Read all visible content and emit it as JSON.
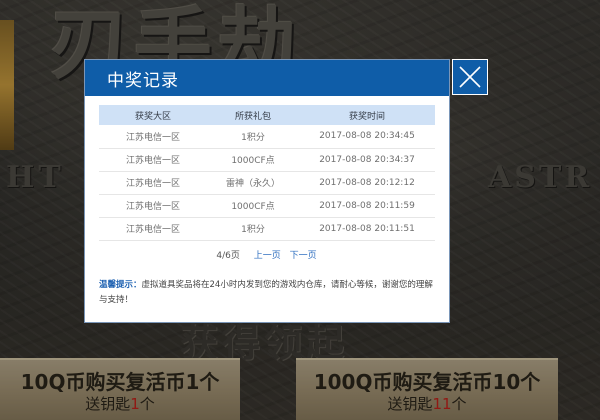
{
  "background": {
    "big_glyphs": "刃手劫",
    "word_left": "HT",
    "word_right": "ASTR",
    "subtitle": "获得领起",
    "cards": [
      {
        "line1": "10Q币购买复活币1个",
        "line2_prefix": "送钥匙",
        "line2_count": "1",
        "line2_suffix": "个"
      },
      {
        "line1": "100Q币购买复活币10个",
        "line2_prefix": "送钥匙",
        "line2_count": "11",
        "line2_suffix": "个"
      }
    ]
  },
  "modal": {
    "title": "中奖记录",
    "close_icon": "close-x-icon",
    "table": {
      "headers": [
        "获奖大区",
        "所获礼包",
        "获奖时间"
      ],
      "rows": [
        [
          "江苏电信一区",
          "1积分",
          "2017-08-08 20:34:45"
        ],
        [
          "江苏电信一区",
          "1000CF点",
          "2017-08-08 20:34:37"
        ],
        [
          "江苏电信一区",
          "雷神（永久）",
          "2017-08-08 20:12:12"
        ],
        [
          "江苏电信一区",
          "1000CF点",
          "2017-08-08 20:11:59"
        ],
        [
          "江苏电信一区",
          "1积分",
          "2017-08-08 20:11:51"
        ]
      ]
    },
    "pager": {
      "page_info": "4/6页",
      "prev_label": "上一页",
      "next_label": "下一页"
    },
    "tips": {
      "label": "温馨提示：",
      "text": "虚拟道具奖品将在24小时内发到您的游戏内仓库，请耐心等候，谢谢您的理解与支持！"
    }
  },
  "colors": {
    "header_blue": "#0f5da8",
    "table_header_bg": "#cfe1f6",
    "link_blue": "#2f6fc0",
    "highlight_red": "#c0221b"
  }
}
